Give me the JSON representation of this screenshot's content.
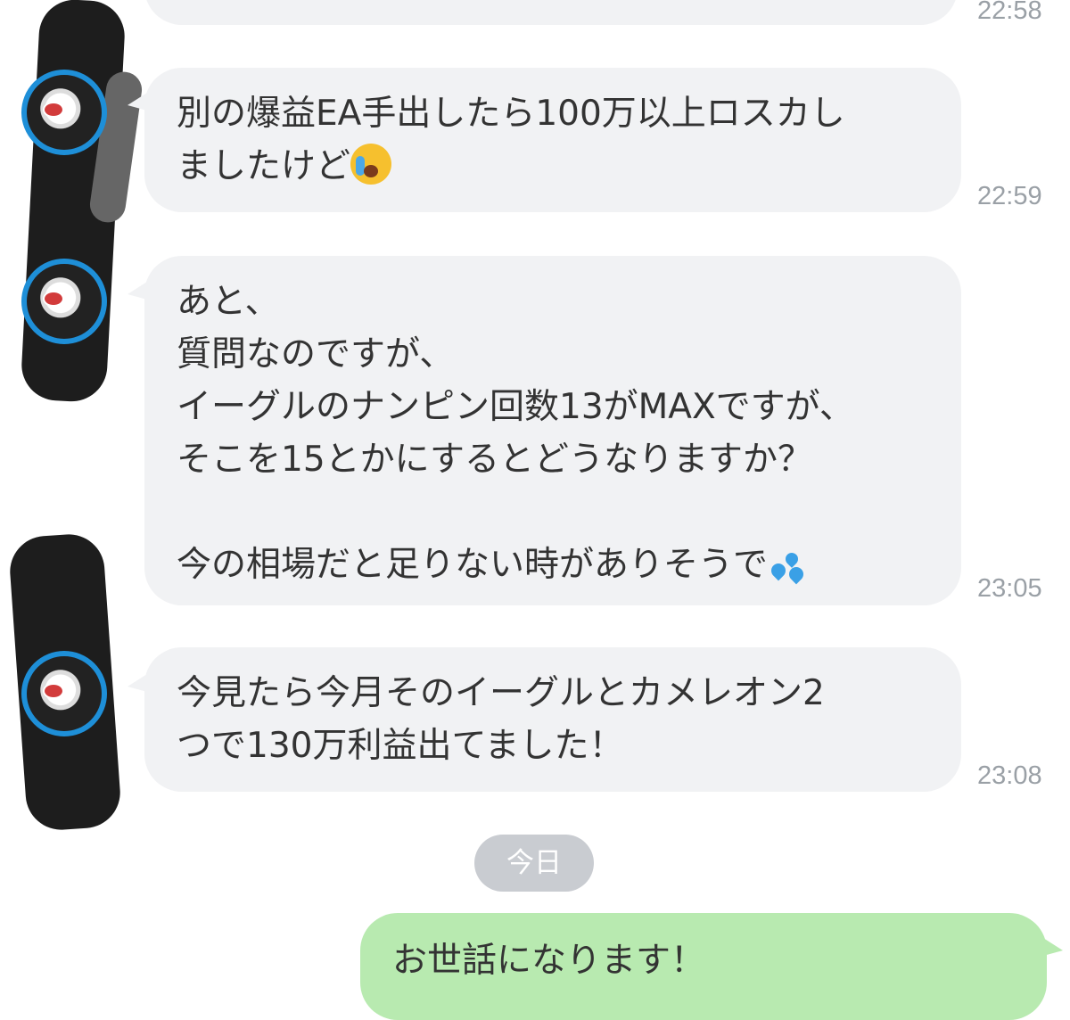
{
  "messages": [
    {
      "id": "m0",
      "text": "",
      "time": "22:58"
    },
    {
      "id": "m1",
      "lines": [
        "別の爆益EA手出したら100万以上ロスカし",
        "ましたけど"
      ],
      "emoji": "loudly-crying-face",
      "time": "22:59"
    },
    {
      "id": "m2",
      "lines": [
        "あと、",
        "質問なのですが、",
        "イーグルのナンピン回数13がMAXですが、",
        "そこを15とかにするとどうなりますか？",
        "",
        "今の相場だと足りない時がありそうで"
      ],
      "emoji": "sweat-droplets",
      "time": "23:05"
    },
    {
      "id": "m3",
      "lines": [
        "今見たら今月そのイーグルとカメレオン2",
        "つで130万利益出てました！"
      ],
      "time": "23:08"
    }
  ],
  "day_separator": "今日",
  "my_message": {
    "text": "お世話になります！"
  },
  "colors": {
    "incoming_bubble": "#f1f2f4",
    "outgoing_bubble": "#b8eab0",
    "timestamp": "#9aa0a6",
    "day_pill": "#c9ccd1",
    "avatar_ring": "#1e8fd8"
  }
}
